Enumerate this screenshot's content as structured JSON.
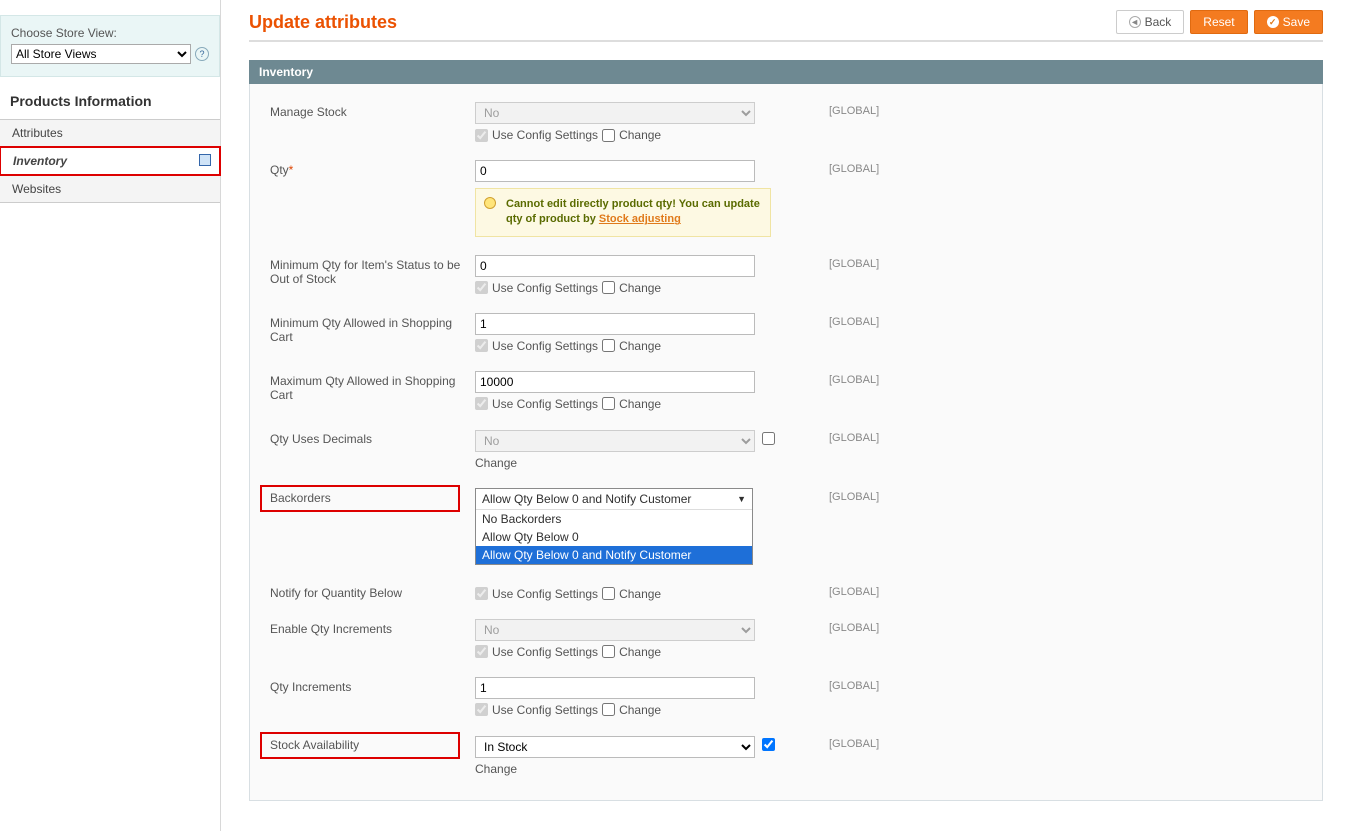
{
  "sidebar": {
    "store_view_label": "Choose Store View:",
    "store_view_value": "All Store Views",
    "heading": "Products Information",
    "tabs": {
      "attributes": "Attributes",
      "inventory": "Inventory",
      "websites": "Websites"
    }
  },
  "header": {
    "title": "Update attributes",
    "back": "Back",
    "reset": "Reset",
    "save": "Save"
  },
  "section_title": "Inventory",
  "common": {
    "use_config": "Use Config Settings",
    "change": "Change",
    "scope_global": "[GLOBAL]"
  },
  "fields": {
    "manage_stock": {
      "label": "Manage Stock",
      "value": "No"
    },
    "qty": {
      "label": "Qty",
      "value": "0"
    },
    "notice": {
      "text_a": "Cannot edit directly product qty! You can update qty of product by ",
      "link": "Stock adjusting"
    },
    "min_qty_out": {
      "label": "Minimum Qty for Item's Status to be Out of Stock",
      "value": "0"
    },
    "min_qty_cart": {
      "label": "Minimum Qty Allowed in Shopping Cart",
      "value": "1"
    },
    "max_qty_cart": {
      "label": "Maximum Qty Allowed in Shopping Cart",
      "value": "10000"
    },
    "qty_decimals": {
      "label": "Qty Uses Decimals",
      "value": "No"
    },
    "backorders": {
      "label": "Backorders",
      "value": "Allow Qty Below 0 and Notify Customer",
      "options": {
        "a": "No Backorders",
        "b": "Allow Qty Below 0",
        "c": "Allow Qty Below 0 and Notify Customer"
      }
    },
    "notify_below": {
      "label": "Notify for Quantity Below"
    },
    "enable_incr": {
      "label": "Enable Qty Increments",
      "value": "No"
    },
    "qty_incr": {
      "label": "Qty Increments",
      "value": "1"
    },
    "stock_avail": {
      "label": "Stock Availability",
      "value": "In Stock"
    }
  }
}
